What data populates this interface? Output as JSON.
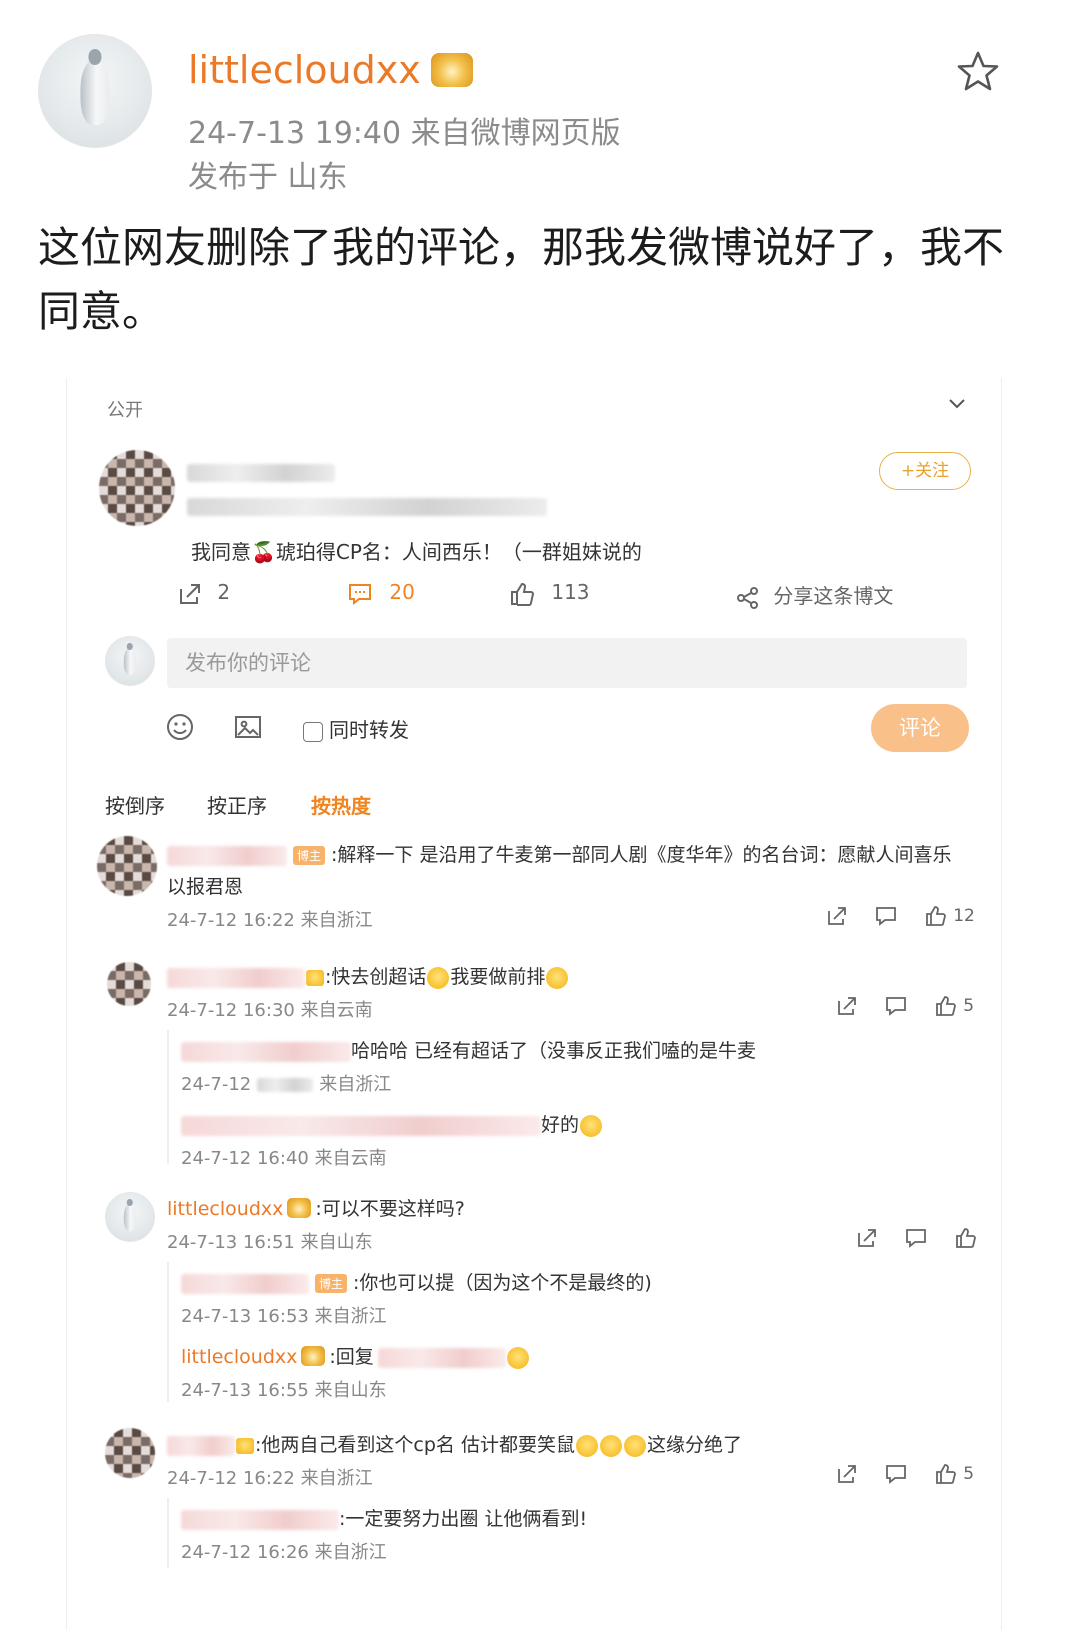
{
  "post": {
    "username": "littlecloudxx",
    "time_source": "24-7-13 19:40  来自微博网页版",
    "location": "发布于 山东",
    "text": "这位网友删除了我的评论，那我发微博说好了，我不同意。"
  },
  "card": {
    "visibility": "公开",
    "follow_label": "+关注",
    "weibo_text": "我同意🍒琥珀得CP名：人间西乐！（一群姐妹说的",
    "repost_count": "2",
    "comment_count": "20",
    "like_count": "113",
    "share_label": "分享这条博文",
    "comment_placeholder": "发布你的评论",
    "also_repost_label": "同时转发",
    "submit_label": "评论",
    "sort": [
      "按倒序",
      "按正序",
      "按热度"
    ]
  },
  "comments": [
    {
      "tag": "博主",
      "text": ":解释一下 是沿用了牛麦第一部同人剧《度华年》的名台词：愿献人间喜乐",
      "text2": "以报君恩",
      "meta": "24-7-12 16:22 来自浙江",
      "likes": "12"
    },
    {
      "text_a": ":快去创超话",
      "text_b": "我要做前排",
      "meta": "24-7-12 16:30 来自云南",
      "likes": "5",
      "replies": [
        {
          "text": "哈哈哈 已经有超话了（没事反正我们嗑的是牛麦",
          "meta_a": "24-7-12",
          "meta_b": "来自浙江"
        },
        {
          "text": "好的",
          "meta": "24-7-12 16:40 来自云南"
        }
      ]
    },
    {
      "username": "littlecloudxx",
      "text": ":可以不要这样吗?",
      "meta": "24-7-13 16:51 来自山东",
      "replies": [
        {
          "tag": "博主",
          "text": ":你也可以提（因为这个不是最终的)",
          "meta": "24-7-13 16:53 来自浙江"
        },
        {
          "username": "littlecloudxx",
          "text": ":回复",
          "meta": "24-7-13 16:55 来自山东"
        }
      ]
    },
    {
      "text_a": ":他两自己看到这个cp名 估计都要笑鼠",
      "text_b": "这缘分绝了",
      "meta": "24-7-12 16:22 来自浙江",
      "likes": "5",
      "replies": [
        {
          "text": ":一定要努力出圈 让他俩看到!",
          "meta": "24-7-12 16:26 来自浙江"
        }
      ]
    }
  ]
}
